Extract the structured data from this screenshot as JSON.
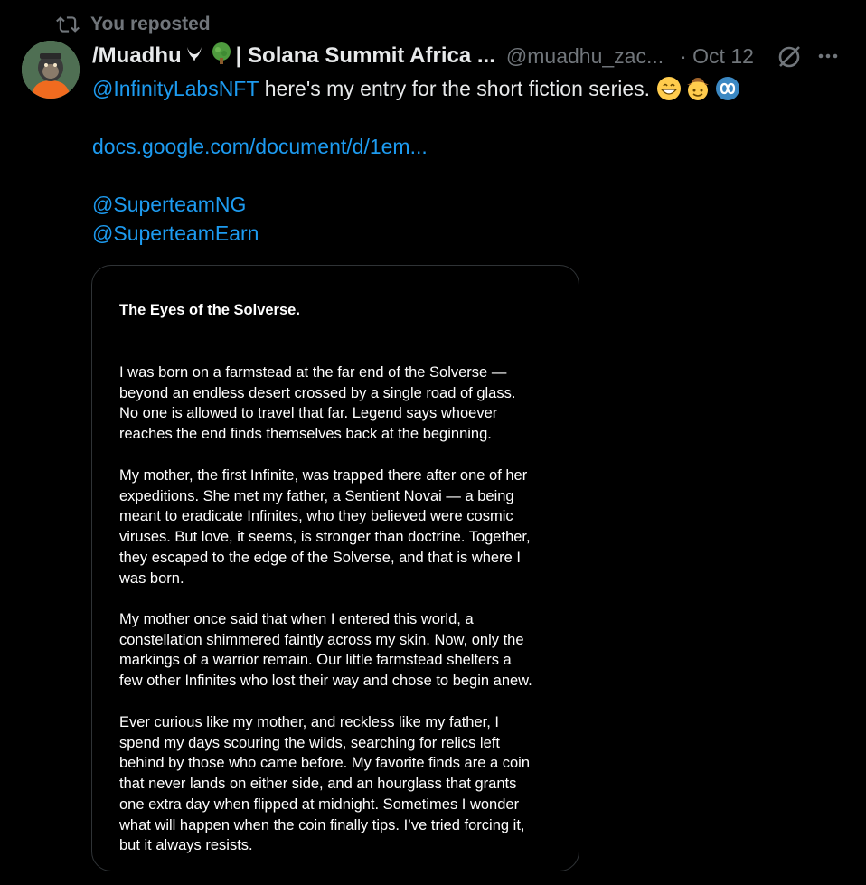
{
  "repost": {
    "label": "You reposted",
    "icon": "repost-icon"
  },
  "author": {
    "name_part1": "/Muadhu",
    "name_part2": "| Solana Summit Africa ...",
    "handle": "@muadhu_zac...",
    "date": "· Oct 12",
    "avatar_icon": "gorilla-avatar"
  },
  "tweet": {
    "mention_main": "@InfinityLabsNFT",
    "text_main": " here's my entry for the short fiction series.",
    "link": "docs.google.com/document/d/1em...",
    "mention_1": "@SuperteamNG",
    "mention_2": "@SuperteamEarn"
  },
  "document": {
    "title": "The Eyes of the Solverse.",
    "paragraphs": [
      [
        "I was born on a farmstead at the far end of the Solverse —",
        "beyond an endless desert crossed by a single road of glass.",
        "No one is allowed to travel that far. Legend says whoever",
        "reaches the end finds themselves back at the beginning."
      ],
      [
        "My mother, the first Infinite, was trapped there after one of her",
        "expeditions. She met my father, a Sentient Novai — a being",
        "meant to eradicate Infinites, who they believed were cosmic",
        "viruses. But love, it seems, is stronger than doctrine. Together,",
        "they escaped to the edge of the Solverse, and that is where I",
        "was born."
      ],
      [
        "My mother once said that when I entered this world, a",
        "constellation shimmered faintly across my skin. Now, only the",
        "markings of a warrior remain. Our little farmstead shelters a",
        "few other Infinites who lost their way and chose to begin anew."
      ],
      [
        "Ever curious like my mother, and reckless like my father, I",
        "spend my days scouring the wilds, searching for relics left",
        "behind by those who came before. My favorite finds are a coin",
        "that never lands on either side, and an hourglass that grants",
        "one extra day when flipped at midnight. Sometimes I wonder",
        "what will happen when the coin finally tips. I’ve tried forcing it,",
        "but it always resists."
      ]
    ]
  },
  "colors": {
    "background": "#000000",
    "text": "#e7e9ea",
    "muted": "#71767b",
    "link": "#1d9bf0"
  }
}
